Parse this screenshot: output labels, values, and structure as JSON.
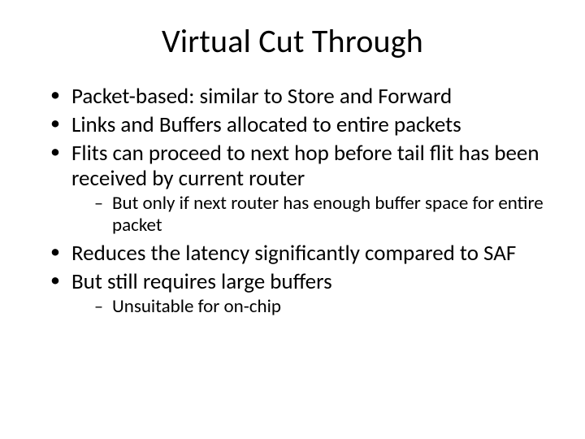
{
  "slide": {
    "title": "Virtual Cut Through",
    "bullets": [
      {
        "text": "Packet-based: similar to Store and Forward"
      },
      {
        "text": "Links and Buffers allocated to entire packets"
      },
      {
        "text": "Flits can proceed to next hop before tail flit has been received by current router",
        "sub": [
          "But only if next router has enough buffer space for entire packet"
        ]
      },
      {
        "text": "Reduces the latency significantly compared to SAF"
      },
      {
        "text": "But still requires large buffers",
        "sub": [
          "Unsuitable for on-chip"
        ]
      }
    ]
  }
}
